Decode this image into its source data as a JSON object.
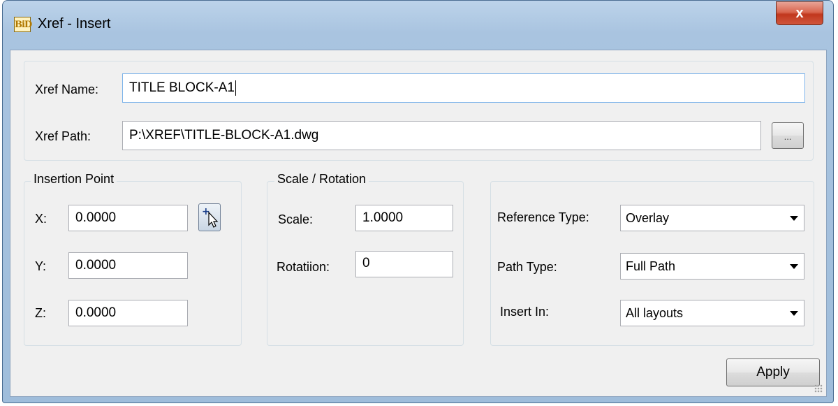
{
  "window": {
    "title": "Xref - Insert",
    "app_icon_text": "BiD",
    "close_label": "x"
  },
  "xref": {
    "name_label": "Xref Name:",
    "name_value": "TITLE BLOCK-A1",
    "path_label": "Xref Path:",
    "path_value": "P:\\XREF\\TITLE-BLOCK-A1.dwg",
    "browse_label": "..."
  },
  "insertion_point": {
    "group_label": "Insertion Point",
    "x_label": "X:",
    "x_value": "0.0000",
    "y_label": "Y:",
    "y_value": "0.0000",
    "z_label": "Z:",
    "z_value": "0.0000",
    "pick_icon": "pick-point-cursor-icon"
  },
  "scale_rotation": {
    "group_label": "Scale / Rotation",
    "scale_label": "Scale:",
    "scale_value": "1.0000",
    "rotation_label": "Rotatiion:",
    "rotation_value": "0"
  },
  "options": {
    "reference_type_label": "Reference Type:",
    "reference_type_value": "Overlay",
    "path_type_label": "Path Type:",
    "path_type_value": "Full Path",
    "insert_in_label": "Insert In:",
    "insert_in_value": "All layouts"
  },
  "actions": {
    "apply_label": "Apply"
  },
  "colors": {
    "title_bar": "#a9c4e0",
    "close_button": "#c1371d",
    "client_background": "#f0f0f0",
    "focus_border": "#7eb4ea"
  }
}
